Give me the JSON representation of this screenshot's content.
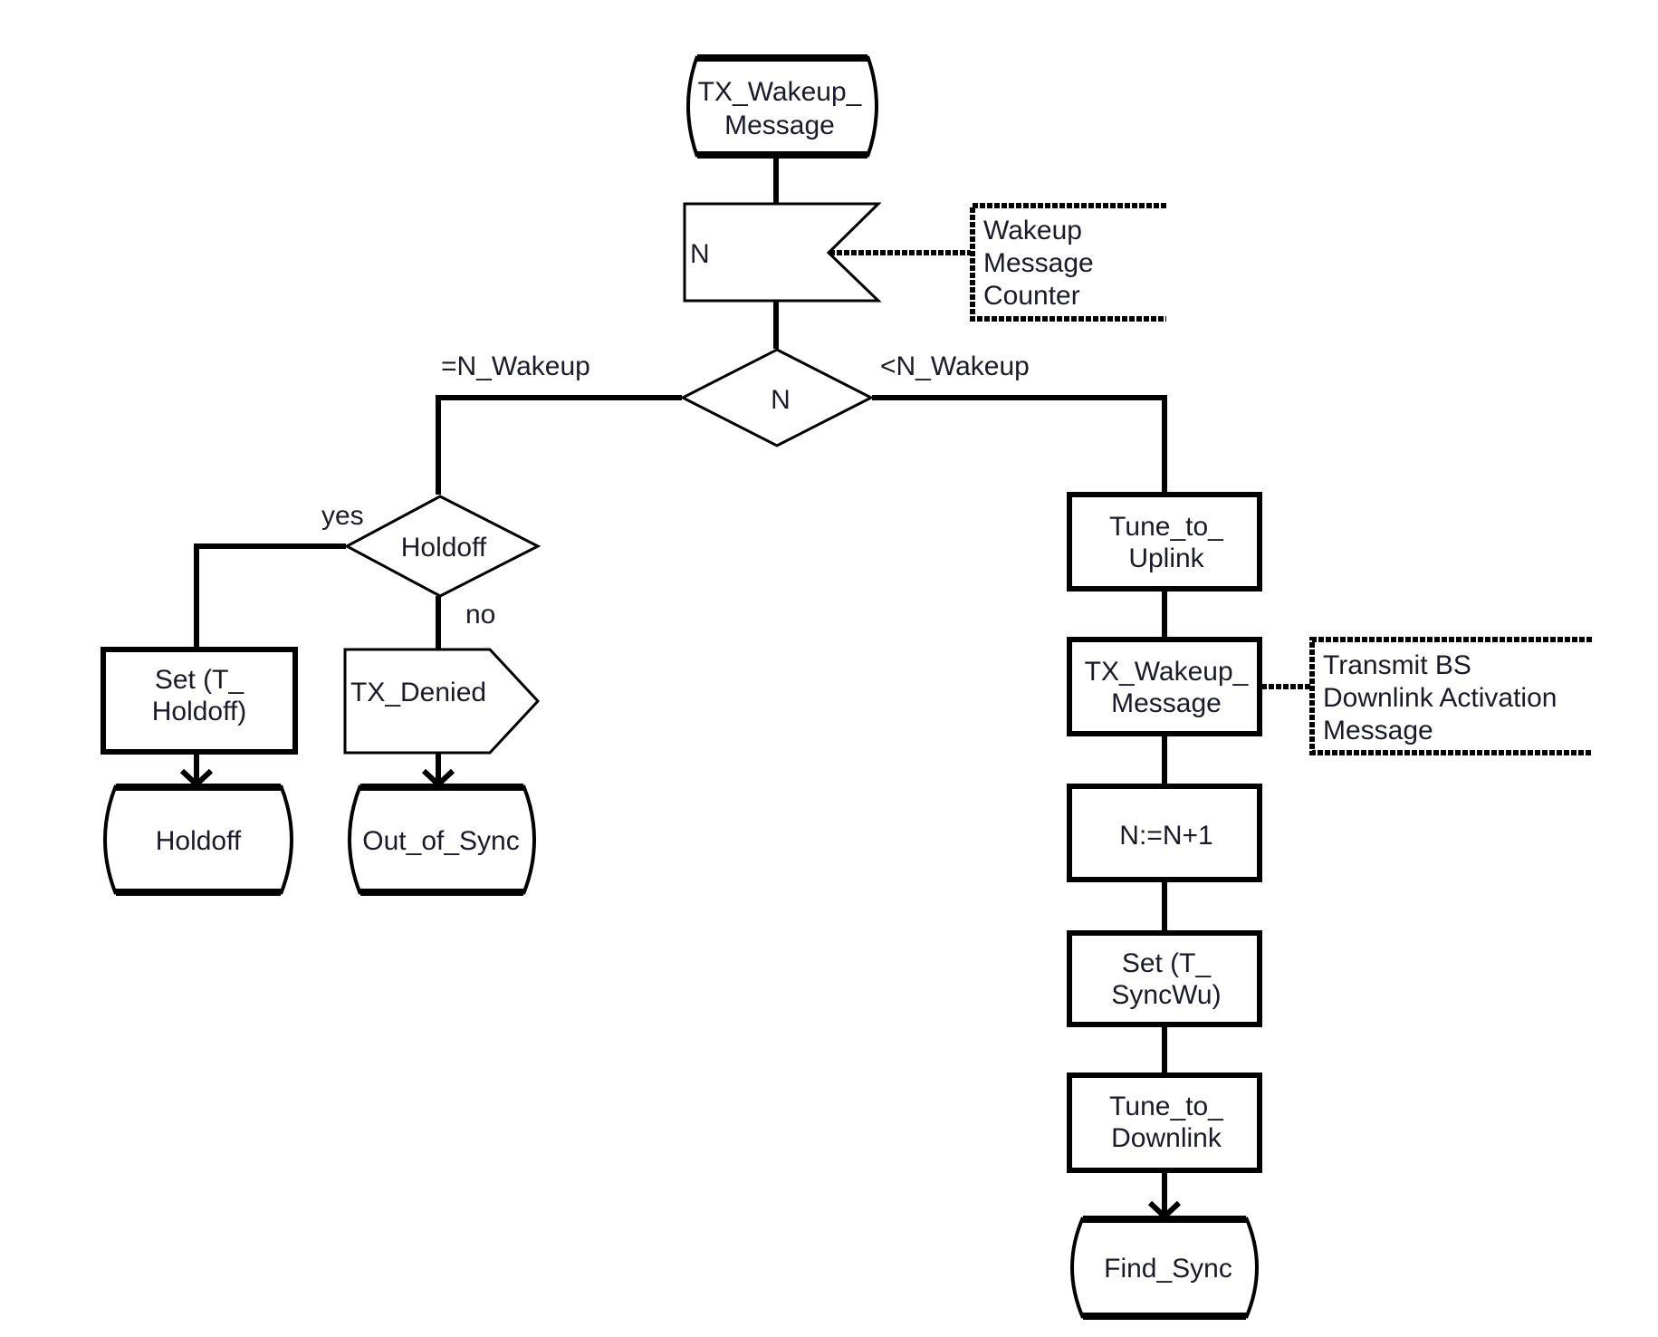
{
  "diagram": {
    "type": "SDL flowchart",
    "colors": {
      "stroke": "#000000",
      "text": "#1a1a2a",
      "background": "#ffffff"
    },
    "nodes": {
      "start_state": {
        "kind": "state",
        "lines": [
          "TX_Wakeup_",
          "Message"
        ]
      },
      "counter": {
        "kind": "input-counter",
        "label": "N"
      },
      "counter_note": {
        "kind": "annotation",
        "lines": [
          "Wakeup",
          "Message",
          "Counter"
        ]
      },
      "decision_n": {
        "kind": "decision",
        "label": "N"
      },
      "decision_holdoff": {
        "kind": "decision",
        "label": "Holdoff"
      },
      "set_holdoff": {
        "kind": "task",
        "lines": [
          "Set (T_",
          "Holdoff)"
        ]
      },
      "tx_denied": {
        "kind": "output",
        "label": "TX_Denied"
      },
      "state_holdoff": {
        "kind": "state",
        "label": "Holdoff"
      },
      "state_out_of_sync": {
        "kind": "state",
        "label": "Out_of_Sync"
      },
      "tune_uplink": {
        "kind": "task",
        "lines": [
          "Tune_to_",
          "Uplink"
        ]
      },
      "tx_wakeup_task": {
        "kind": "task",
        "lines": [
          "TX_Wakeup_",
          "Message"
        ]
      },
      "tx_note": {
        "kind": "annotation",
        "lines": [
          "Transmit  BS",
          "Downlink Activation",
          "Message"
        ]
      },
      "increment": {
        "kind": "task",
        "label": "N:=N+1"
      },
      "set_syncwu": {
        "kind": "task",
        "lines": [
          "Set (T_",
          "SyncWu)"
        ]
      },
      "tune_downlink": {
        "kind": "task",
        "lines": [
          "Tune_to_",
          "Downlink"
        ]
      },
      "state_find_sync": {
        "kind": "state",
        "label": "Find_Sync"
      }
    },
    "edge_labels": {
      "eq_wakeup": "=N_Wakeup",
      "lt_wakeup": "<N_Wakeup",
      "yes": "yes",
      "no": "no"
    }
  }
}
